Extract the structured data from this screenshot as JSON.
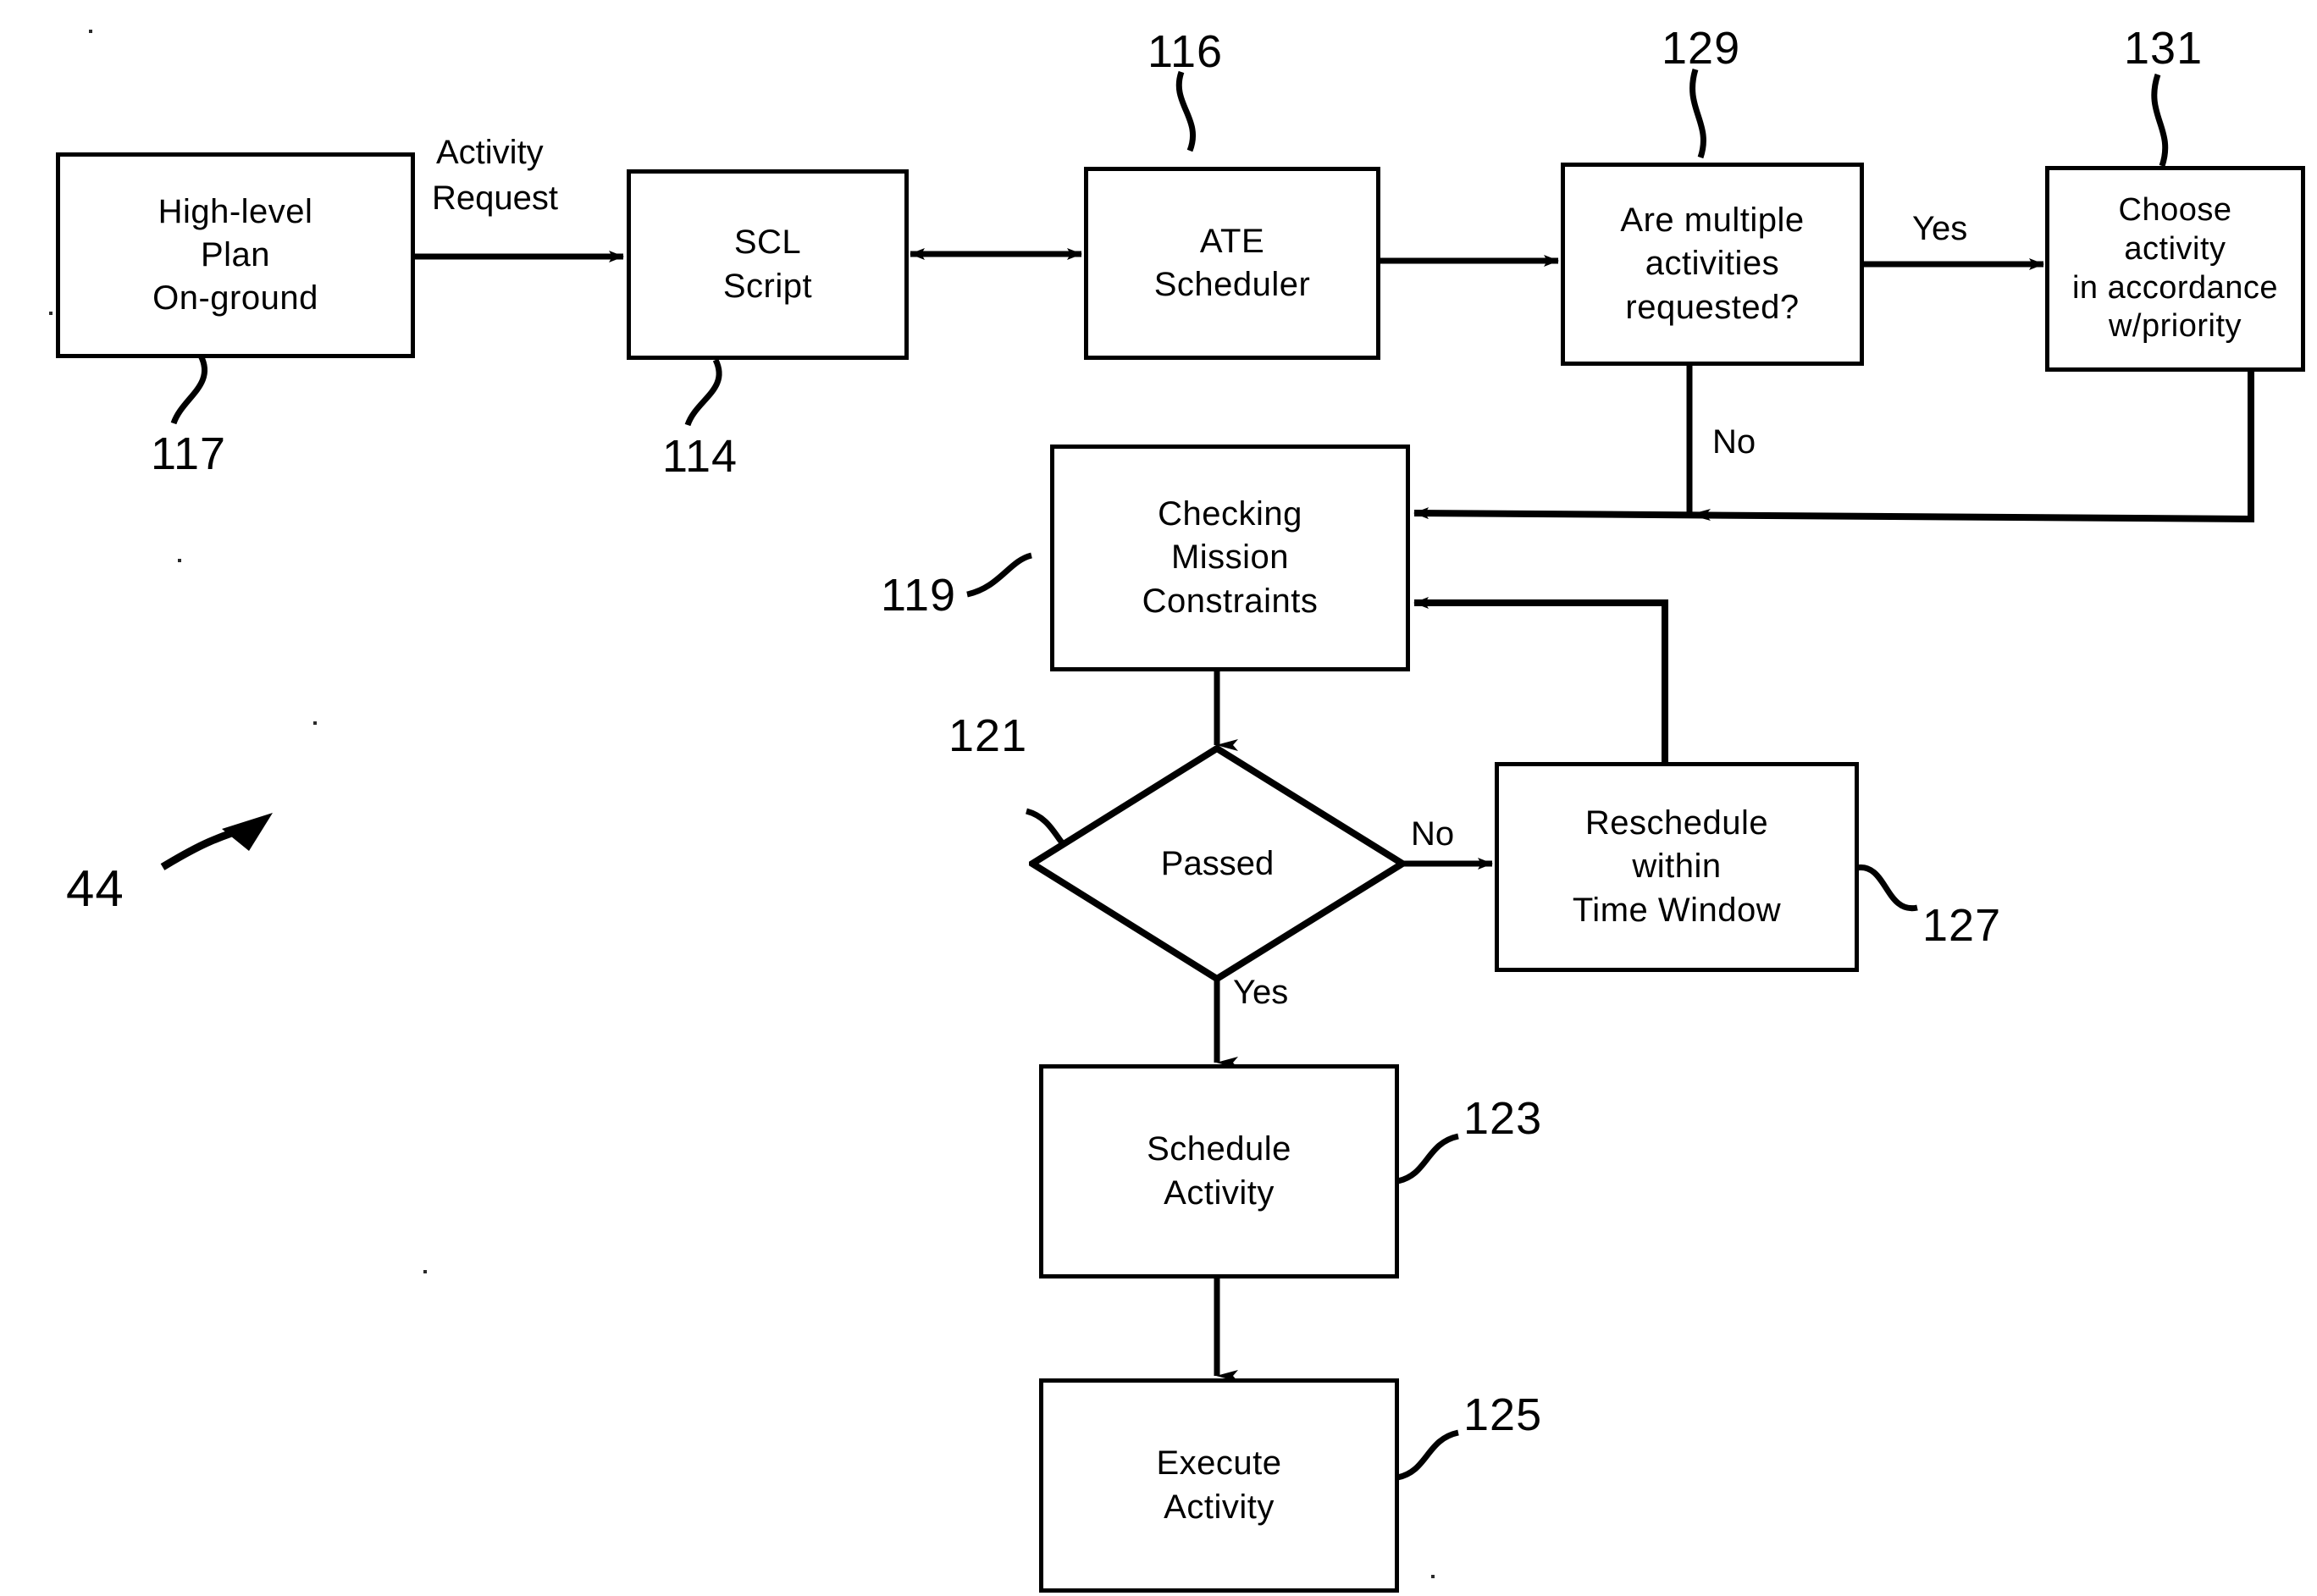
{
  "figure": {
    "kind": "patent-flowchart",
    "figure_ref": "44",
    "stroke_color": "#000000",
    "background_color": "#ffffff"
  },
  "nodes": {
    "high_level_plan": {
      "lines": [
        "High-level",
        "Plan",
        "On-ground"
      ],
      "ref": "117",
      "shape": "rect"
    },
    "scl_script": {
      "lines": [
        "SCL",
        "Script"
      ],
      "ref": "114",
      "shape": "rect"
    },
    "ate_scheduler": {
      "lines": [
        "ATE",
        "Scheduler"
      ],
      "ref": "116",
      "shape": "rect"
    },
    "multiple_activities": {
      "lines": [
        "Are  multiple",
        "activities",
        "requested?"
      ],
      "ref": "129",
      "shape": "rect"
    },
    "choose_activity": {
      "lines": [
        "Choose",
        "activity",
        "in  accordance",
        "w/priority"
      ],
      "ref": "131",
      "shape": "rect"
    },
    "checking_constraints": {
      "lines": [
        "Checking",
        "Mission",
        "Constraints"
      ],
      "ref": "119",
      "shape": "rect"
    },
    "passed": {
      "lines": [
        "Passed"
      ],
      "ref": "121",
      "shape": "diamond"
    },
    "reschedule": {
      "lines": [
        "Reschedule",
        "within",
        "Time  Window"
      ],
      "ref": "127",
      "shape": "rect"
    },
    "schedule_activity": {
      "lines": [
        "Schedule",
        "Activity"
      ],
      "ref": "123",
      "shape": "rect"
    },
    "execute_activity": {
      "lines": [
        "Execute",
        "Activity"
      ],
      "ref": "125",
      "shape": "rect"
    }
  },
  "edge_labels": {
    "activity_request": "Activity\nRequest",
    "activity_request_l1": "Activity",
    "activity_request_l2": "Request",
    "multiple_yes": "Yes",
    "multiple_no": "No",
    "passed_no": "No",
    "passed_yes": "Yes"
  },
  "refs": {
    "fig": "44",
    "r114": "114",
    "r116": "116",
    "r117": "117",
    "r119": "119",
    "r121": "121",
    "r123": "123",
    "r125": "125",
    "r127": "127",
    "r129": "129",
    "r131": "131"
  }
}
